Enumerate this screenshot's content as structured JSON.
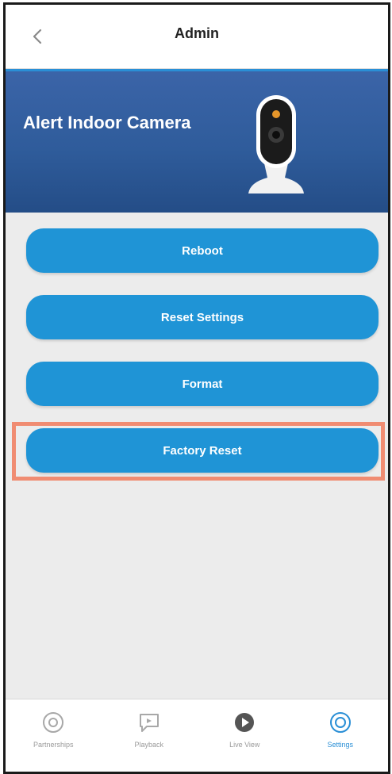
{
  "header": {
    "title": "Admin",
    "back_icon": "chevron-left-icon"
  },
  "banner": {
    "title": "Alert Indoor Camera",
    "image": "indoor-camera-image"
  },
  "actions": {
    "reboot": "Reboot",
    "reset_settings": "Reset Settings",
    "format": "Format",
    "factory_reset": "Factory Reset"
  },
  "tabs": [
    {
      "label": "Partnerships",
      "icon": "record-icon"
    },
    {
      "label": "Playback",
      "icon": "chat-icon"
    },
    {
      "label": "Live View",
      "icon": "play-icon"
    },
    {
      "label": "Settings",
      "icon": "settings-icon",
      "active": true
    }
  ],
  "colors": {
    "accent": "#1f94d6",
    "banner": "#2f5c9b",
    "highlight": "#f08c72",
    "background": "#ececec"
  }
}
